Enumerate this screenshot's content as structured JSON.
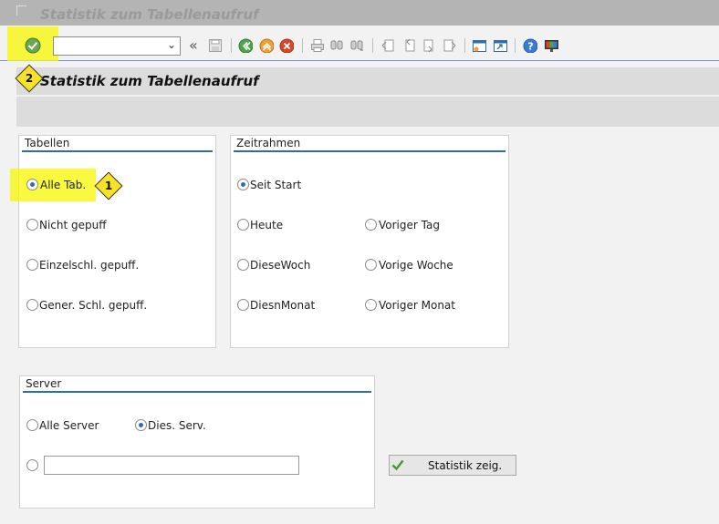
{
  "window": {
    "title": "Statistik zum Tabellenaufruf"
  },
  "toolbar": {
    "command_field_value": "",
    "icons": [
      "enter-icon",
      "back-arrows-icon",
      "save-icon",
      "back-icon",
      "exit-icon",
      "cancel-icon",
      "print-icon",
      "find-icon",
      "find-next-icon",
      "first-page-icon",
      "previous-page-icon",
      "next-page-icon",
      "last-page-icon",
      "new-session-icon",
      "shortcut-icon",
      "help-icon",
      "customize-layout-icon"
    ],
    "nav_glyph": "«"
  },
  "header": {
    "title": "Statistik zum Tabellenaufruf"
  },
  "tabellen": {
    "title": "Tabellen",
    "options": [
      {
        "label": "Alle Tab.",
        "selected": true
      },
      {
        "label": "Nicht gepuff",
        "selected": false
      },
      {
        "label": "Einzelschl. gepuff.",
        "selected": false
      },
      {
        "label": "Gener. Schl. gepuff.",
        "selected": false
      }
    ]
  },
  "zeitrahmen": {
    "title": "Zeitrahmen",
    "options": [
      {
        "label": "Seit Start",
        "selected": true
      },
      {
        "label": "Heute",
        "selected": false
      },
      {
        "label": "Voriger Tag",
        "selected": false
      },
      {
        "label": "DieseWoch",
        "selected": false
      },
      {
        "label": "Vorige Woche",
        "selected": false
      },
      {
        "label": "DiesnMonat",
        "selected": false
      },
      {
        "label": "Voriger Monat",
        "selected": false
      }
    ]
  },
  "server": {
    "title": "Server",
    "options": [
      {
        "label": "Alle Server",
        "selected": false
      },
      {
        "label": "Dies. Serv.",
        "selected": true
      }
    ],
    "custom_value": ""
  },
  "actions": {
    "statistik_label": "Statistik zeig."
  },
  "badges": {
    "one": "1",
    "two": "2"
  },
  "colors": {
    "highlight": "#f7f700",
    "accent_line": "#2f6ea5",
    "badge": "#f7e22a"
  }
}
